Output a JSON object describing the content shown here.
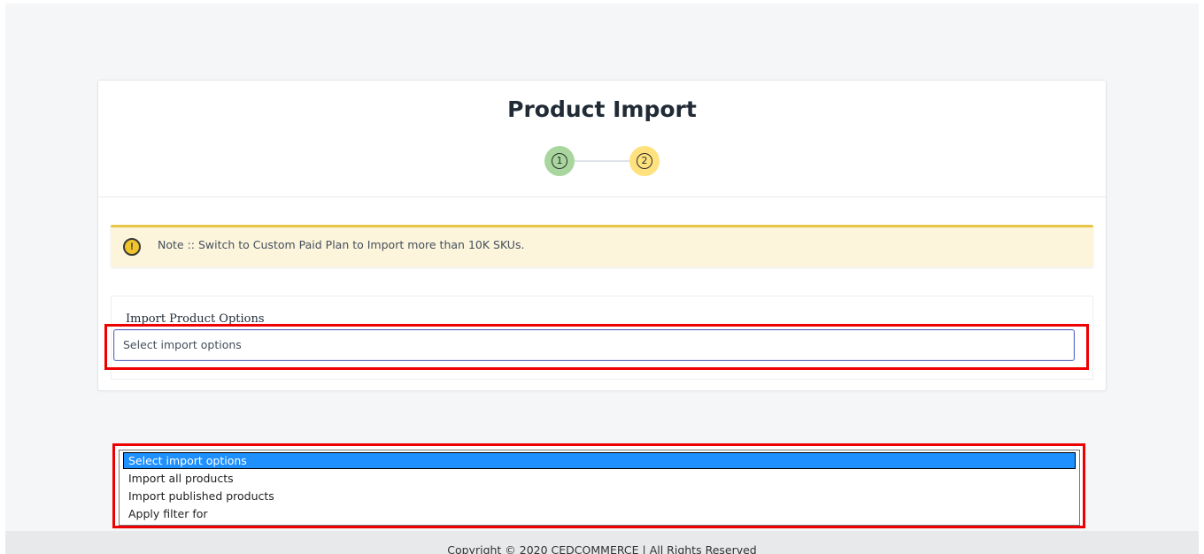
{
  "page": {
    "title": "Product Import"
  },
  "stepper": {
    "steps": [
      {
        "label": "1",
        "state": "completed",
        "color": "#a8d69e"
      },
      {
        "label": "2",
        "state": "current",
        "color": "#ffe27d"
      }
    ]
  },
  "banner": {
    "icon": "warning-icon",
    "text": "Note :: Switch to Custom Paid Plan to Import more than 10K SKUs.",
    "accent_color": "#e8c547"
  },
  "import_options": {
    "label": "Import Product Options",
    "selected_value": "Select import options",
    "options": [
      "Select import options",
      "Import all products",
      "Import published products",
      "Apply filter for"
    ],
    "selected_index": 0
  },
  "footer": {
    "text": "Copyright © 2020 CEDCOMMERCE | All Rights Reserved"
  },
  "colors": {
    "highlight": "#ee0000",
    "focus_border": "#5c6ac4",
    "selected_option": "#1e90ff"
  }
}
